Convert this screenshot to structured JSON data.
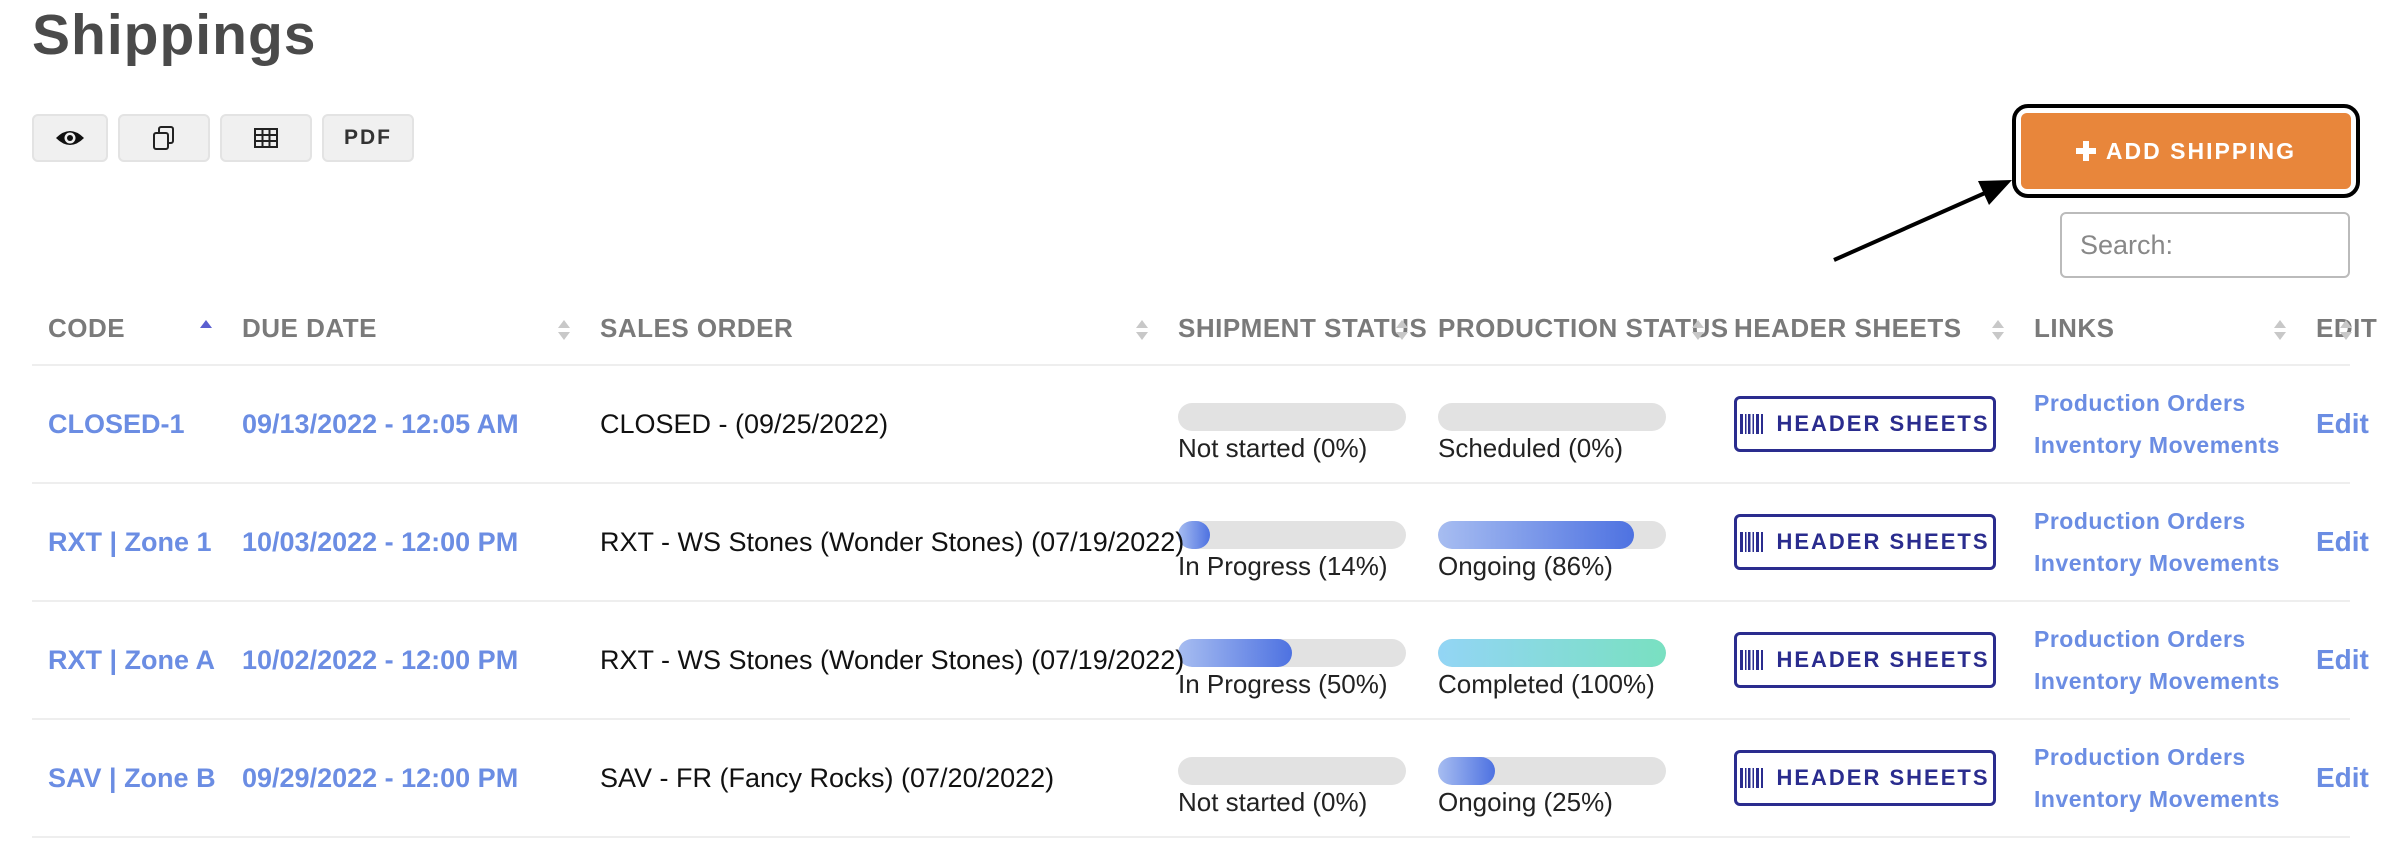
{
  "page_title": "Shippings",
  "toolbar": {
    "view_icon": "eye-icon",
    "copy_icon": "copy-icon",
    "table_icon": "table-icon",
    "pdf_label": "PDF"
  },
  "add_button": {
    "icon": "plus-icon",
    "label": "ADD SHIPPING",
    "color": "#e8863b"
  },
  "search": {
    "placeholder": "Search:",
    "value": ""
  },
  "columns": {
    "code": "CODE",
    "due_date": "DUE DATE",
    "sales_order": "SALES ORDER",
    "shipment_status": "SHIPMENT STATUS",
    "production_status": "PRODUCTION STATUS",
    "header_sheets": "HEADER SHEETS",
    "links": "LINKS",
    "edit": "EDIT"
  },
  "rows": [
    {
      "code": "CLOSED-1",
      "due_date": "09/13/2022 - 12:05 AM",
      "sales_order": "CLOSED - (09/25/2022)",
      "shipment_status": "Not started (0%)",
      "shipment_pct": 0,
      "production_status": "Scheduled (0%)",
      "production_pct": 0,
      "header_sheets": "HEADER SHEETS",
      "link_1": "Production Orders",
      "link_2": "Inventory Movements",
      "edit": "Edit"
    },
    {
      "code": "RXT | Zone 1",
      "due_date": "10/03/2022 - 12:00 PM",
      "sales_order": "RXT - WS Stones (Wonder Stones) (07/19/2022)",
      "shipment_status": "In Progress (14%)",
      "shipment_pct": 14,
      "production_status": "Ongoing (86%)",
      "production_pct": 86,
      "header_sheets": "HEADER SHEETS",
      "link_1": "Production Orders",
      "link_2": "Inventory Movements",
      "edit": "Edit"
    },
    {
      "code": "RXT | Zone A",
      "due_date": "10/02/2022 - 12:00 PM",
      "sales_order": "RXT - WS Stones (Wonder Stones) (07/19/2022)",
      "shipment_status": "In Progress (50%)",
      "shipment_pct": 50,
      "production_status": "Completed (100%)",
      "production_pct": 100,
      "header_sheets": "HEADER SHEETS",
      "link_1": "Production Orders",
      "link_2": "Inventory Movements",
      "edit": "Edit"
    },
    {
      "code": "SAV | Zone B",
      "due_date": "09/29/2022 - 12:00 PM",
      "sales_order": "SAV - FR (Fancy Rocks) (07/20/2022)",
      "shipment_status": "Not started (0%)",
      "shipment_pct": 0,
      "production_status": "Ongoing (25%)",
      "production_pct": 25,
      "header_sheets": "HEADER SHEETS",
      "link_1": "Production Orders",
      "link_2": "Inventory Movements",
      "edit": "Edit"
    }
  ],
  "colors": {
    "link": "#6b8de3",
    "header_sheets_border": "#2a2c8e",
    "progress_blue": "#4e72e1",
    "progress_complete": "#79e0c1"
  }
}
